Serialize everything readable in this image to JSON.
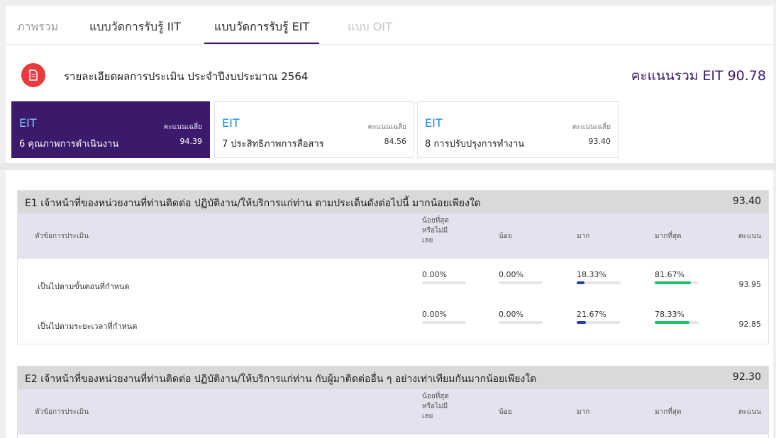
{
  "tabs": [
    {
      "label": "ภาพรวม",
      "state": "dim"
    },
    {
      "label": "แบบวัดการรับรู้ IIT",
      "state": "normal"
    },
    {
      "label": "แบบวัดการรับรู้ EIT",
      "state": "active"
    },
    {
      "label": "แบบ OIT",
      "state": "light"
    }
  ],
  "header": {
    "icon": "document-icon",
    "title": "รายละเอียดผลการประเมิน ประจำปีงบประมาณ 2564",
    "total_score": "คะแนนรวม EIT 90.78"
  },
  "eit_cards": [
    {
      "tag": "EIT",
      "name": "6 คุณภาพการดำเนินงาน",
      "avg_label": "คะแนนเฉลี่ย",
      "avg": "94.39",
      "active": true
    },
    {
      "tag": "EIT",
      "name": "7 ประสิทธิภาพการสื่อสาร",
      "avg_label": "คะแนนเฉลี่ย",
      "avg": "84.56",
      "active": false
    },
    {
      "tag": "EIT",
      "name": "8 การปรับปรุงการทำงาน",
      "avg_label": "คะแนนเฉลี่ย",
      "avg": "93.40",
      "active": false
    }
  ],
  "table_headers": {
    "topic": "หัวข้อการประเมิน",
    "least": [
      "น้อยที่สุด",
      "หรือไม่มี",
      "เลย"
    ],
    "little": "น้อย",
    "much": "มาก",
    "most": "มากที่สุด",
    "score": "คะแนน"
  },
  "sections": [
    {
      "title": "E1 เจ้าหน้าที่ของหน่วยงานที่ท่านติดต่อ ปฏิบัติงาน/ให้บริการแก่ท่าน ตามประเด็นดังต่อไปนี้ มากน้อยเพียงใด",
      "score": "93.40",
      "rows": [
        {
          "label": "เป็นไปตามขั้นตอนที่กำหนด",
          "least": "0.00%",
          "little": "0.00%",
          "much": "18.33%",
          "most": "81.67%",
          "score": "93.95",
          "least_v": 0,
          "little_v": 0,
          "much_v": 18.33,
          "most_v": 81.67
        },
        {
          "label": "เป็นไปตามระยะเวลาที่กำหนด",
          "least": "0.00%",
          "little": "0.00%",
          "much": "21.67%",
          "most": "78.33%",
          "score": "92.85",
          "least_v": 0,
          "little_v": 0,
          "much_v": 21.67,
          "most_v": 78.33
        }
      ]
    },
    {
      "title": "E2 เจ้าหน้าที่ของหน่วยงานที่ท่านติดต่อ ปฏิบัติงาน/ให้บริการแก่ท่าน กับผู้มาติดต่ออื่น ๆ อย่างเท่าเทียมกันมากน้อยเพียงใด",
      "score": "92.30",
      "rows": []
    }
  ],
  "colors": {
    "primary": "#3c1a6b",
    "eit_tag": "#1e88e5",
    "icon_bg": "#e93b3b",
    "bar_much": "#2541a8",
    "bar_most": "#22c26a"
  }
}
